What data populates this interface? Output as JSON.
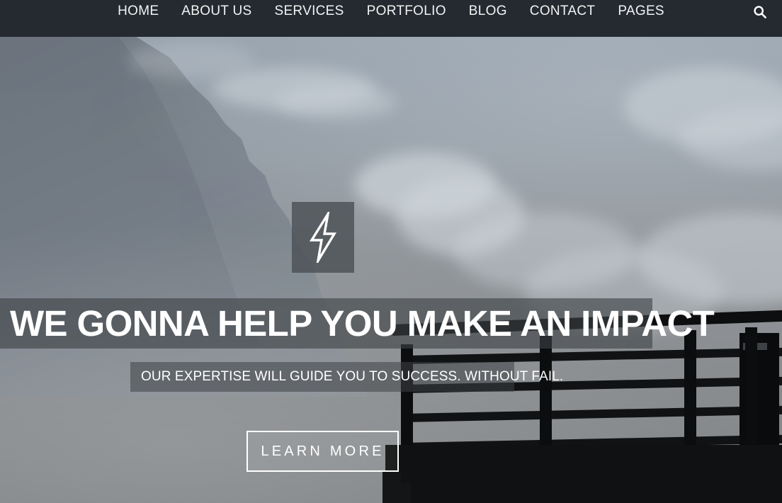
{
  "header": {
    "nav_items": [
      {
        "label": "HOME",
        "name": "home"
      },
      {
        "label": "ABOUT US",
        "name": "about-us"
      },
      {
        "label": "SERVICES",
        "name": "services"
      },
      {
        "label": "PORTFOLIO",
        "name": "portfolio"
      },
      {
        "label": "BLOG",
        "name": "blog"
      },
      {
        "label": "CONTACT",
        "name": "contact"
      },
      {
        "label": "PAGES",
        "name": "pages"
      }
    ],
    "search_icon": "search-icon",
    "background_color": "#252a31",
    "text_color": "#f2f2f2"
  },
  "hero": {
    "logo_icon": "lightning-bolt-icon",
    "logo_box_color": "#4a4f54",
    "headline": "WE GONNA HELP YOU MAKE AN IMPACT",
    "subheadline": "OUR EXPERTISE WILL GUIDE YOU TO SUCCESS. WITHOUT FAIL.",
    "cta_label": "LEARN MORE",
    "text_color": "#ffffff",
    "band_color": "#3e4246",
    "background_description": "mountain-and-sky-photograph"
  }
}
